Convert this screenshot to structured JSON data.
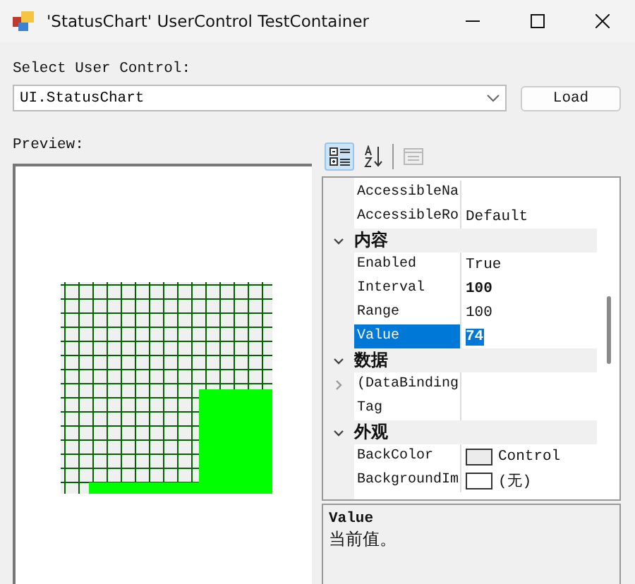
{
  "window": {
    "title": "'StatusChart' UserControl TestContainer"
  },
  "select_label": "Select User Control:",
  "control_combo": {
    "value": "UI.StatusChart"
  },
  "load_button": "Load",
  "preview_label": "Preview:",
  "toolbar": [
    {
      "kind": "categorized",
      "selected": true,
      "disabled": false
    },
    {
      "kind": "alphabetical",
      "selected": false,
      "disabled": false
    },
    {
      "kind": "pages",
      "selected": false,
      "disabled": true
    }
  ],
  "properties": [
    {
      "kind": "property",
      "name": "AccessibleNa",
      "selected": false
    },
    {
      "kind": "property",
      "name": "AccessibleRo",
      "value": "Default",
      "modified": false,
      "selected": false
    },
    {
      "kind": "category",
      "name": "内容",
      "expanded": true
    },
    {
      "kind": "property",
      "name": "Enabled",
      "value": "True",
      "modified": false,
      "selected": false
    },
    {
      "kind": "property",
      "name": "Interval",
      "value": "100",
      "modified": true,
      "selected": false
    },
    {
      "kind": "property",
      "name": "Range",
      "value": "100",
      "modified": false,
      "selected": false
    },
    {
      "kind": "property",
      "name": "Value",
      "value": "74",
      "modified": true,
      "selected": true
    },
    {
      "kind": "category",
      "name": "数据",
      "expanded": true
    },
    {
      "kind": "expandable",
      "name": "(DataBinding",
      "expanded": false
    },
    {
      "kind": "property",
      "name": "Tag",
      "selected": false
    },
    {
      "kind": "category",
      "name": "外观",
      "expanded": true
    },
    {
      "kind": "swatch",
      "name": "BackColor",
      "value": "Control",
      "color": "#ececec"
    },
    {
      "kind": "swatch",
      "name": "BackgroundIm",
      "value": "(无)",
      "color": "#ffffff"
    }
  ],
  "description": {
    "title": "Value",
    "text": "当前值。"
  }
}
